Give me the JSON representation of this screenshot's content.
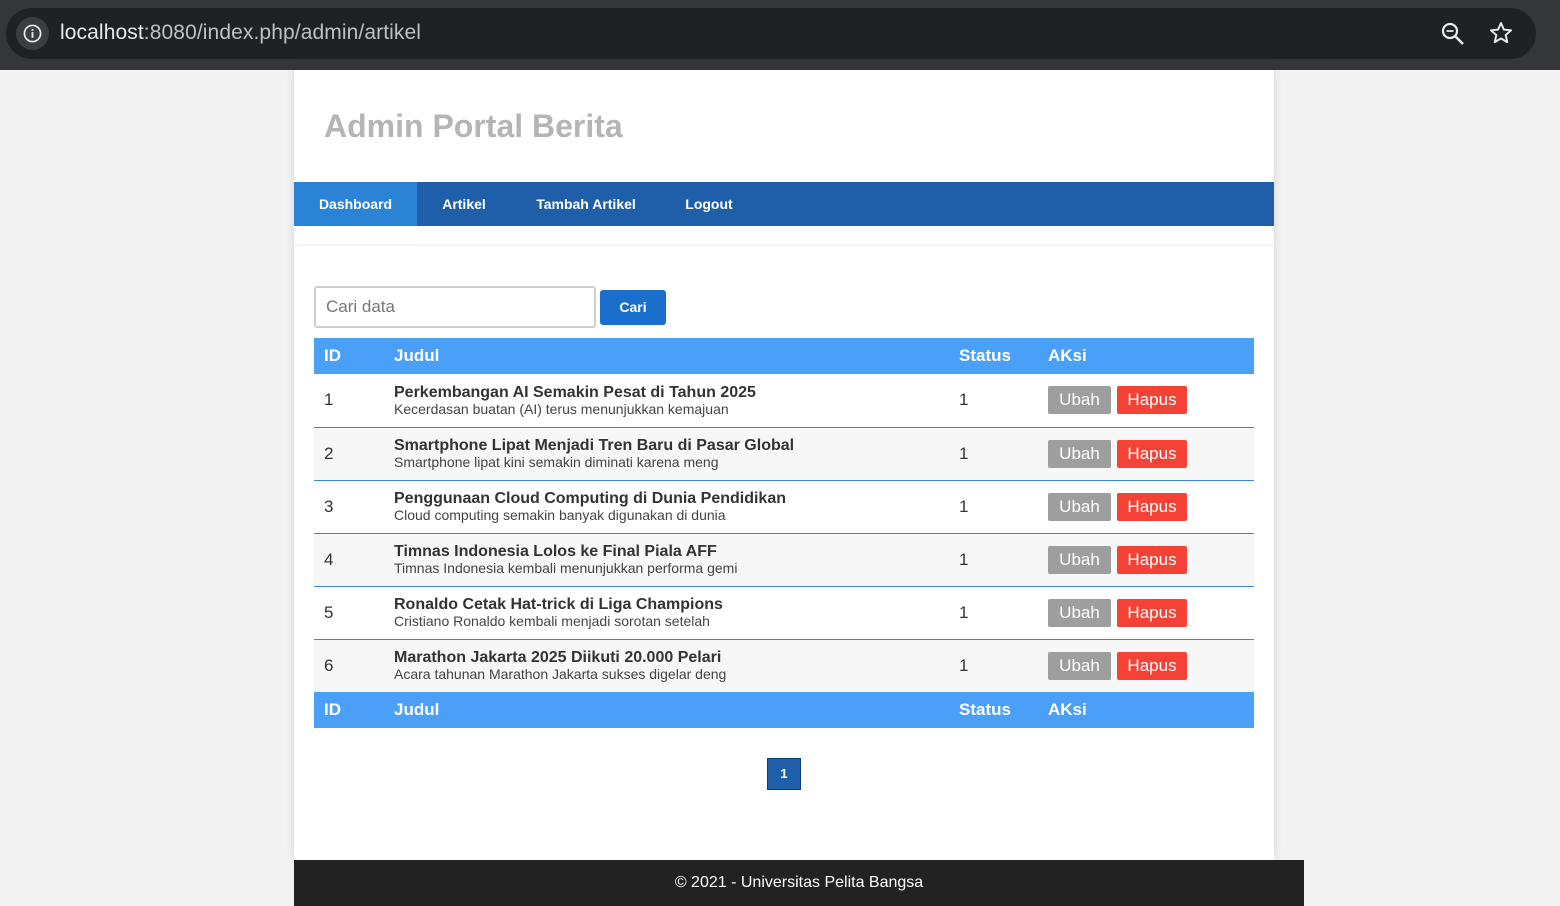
{
  "browser": {
    "url_host": "localhost",
    "url_path": ":8080/index.php/admin/artikel"
  },
  "site": {
    "title": "Admin Portal Berita"
  },
  "nav": {
    "items": [
      {
        "label": "Dashboard",
        "active": true
      },
      {
        "label": "Artikel",
        "active": false
      },
      {
        "label": "Tambah Artikel",
        "active": false
      },
      {
        "label": "Logout",
        "active": false
      }
    ]
  },
  "search": {
    "placeholder": "Cari data",
    "button_label": "Cari"
  },
  "table": {
    "headers": [
      "ID",
      "Judul",
      "Status",
      "AKsi"
    ],
    "rows": [
      {
        "id": "1",
        "title": "Perkembangan AI Semakin Pesat di Tahun 2025",
        "desc": "Kecerdasan buatan (AI) terus menunjukkan kemajuan",
        "status": "1"
      },
      {
        "id": "2",
        "title": "Smartphone Lipat Menjadi Tren Baru di Pasar Global",
        "desc": "Smartphone lipat kini semakin diminati karena meng",
        "status": "1"
      },
      {
        "id": "3",
        "title": "Penggunaan Cloud Computing di Dunia Pendidikan",
        "desc": "Cloud computing semakin banyak digunakan di dunia",
        "status": "1"
      },
      {
        "id": "4",
        "title": "Timnas Indonesia Lolos ke Final Piala AFF",
        "desc": "Timnas Indonesia kembali menunjukkan performa gemi",
        "status": "1"
      },
      {
        "id": "5",
        "title": "Ronaldo Cetak Hat-trick di Liga Champions",
        "desc": "Cristiano Ronaldo kembali menjadi sorotan setelah",
        "status": "1"
      },
      {
        "id": "6",
        "title": "Marathon Jakarta 2025 Diikuti 20.000 Pelari",
        "desc": "Acara tahunan Marathon Jakarta sukses digelar deng",
        "status": "1"
      }
    ],
    "edit_label": "Ubah",
    "delete_label": "Hapus"
  },
  "pagination": {
    "current": "1"
  },
  "footer": {
    "text": "© 2021 - Universitas Pelita Bangsa"
  },
  "colors": {
    "nav_bg": "#1f5faa",
    "nav_active": "#2b83d6",
    "table_header": "#4aa0f7",
    "btn_edit": "#9e9e9e",
    "btn_delete": "#f44336",
    "btn_search": "#1b6fcc",
    "footer_bg": "#222222"
  }
}
